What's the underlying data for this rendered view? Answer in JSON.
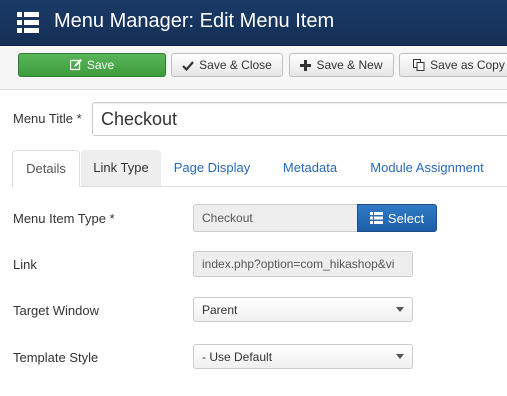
{
  "header": {
    "title": "Menu Manager: Edit Menu Item",
    "icon": "menu-list-icon"
  },
  "toolbar": {
    "save_label": "Save",
    "save_close_label": "Save & Close",
    "save_new_label": "Save & New",
    "save_copy_label": "Save as Copy"
  },
  "form": {
    "menu_title_label": "Menu Title *",
    "menu_title_value": "Checkout"
  },
  "tabs": [
    {
      "label": "Details",
      "active": true
    },
    {
      "label": "Link Type"
    },
    {
      "label": "Page Display"
    },
    {
      "label": "Metadata"
    },
    {
      "label": "Module Assignment"
    }
  ],
  "details": {
    "menu_item_type_label": "Menu Item Type *",
    "menu_item_type_value": "Checkout",
    "select_label": "Select",
    "link_label": "Link",
    "link_value": "index.php?option=com_hikashop&vi",
    "target_window_label": "Target Window",
    "target_window_value": "Parent",
    "template_style_label": "Template Style",
    "template_style_value": "- Use Default"
  },
  "colors": {
    "header_bg": "#1a3a67",
    "save_green": "#4cae4c",
    "select_blue": "#2a6fb7",
    "tab_link": "#2a69b8"
  }
}
